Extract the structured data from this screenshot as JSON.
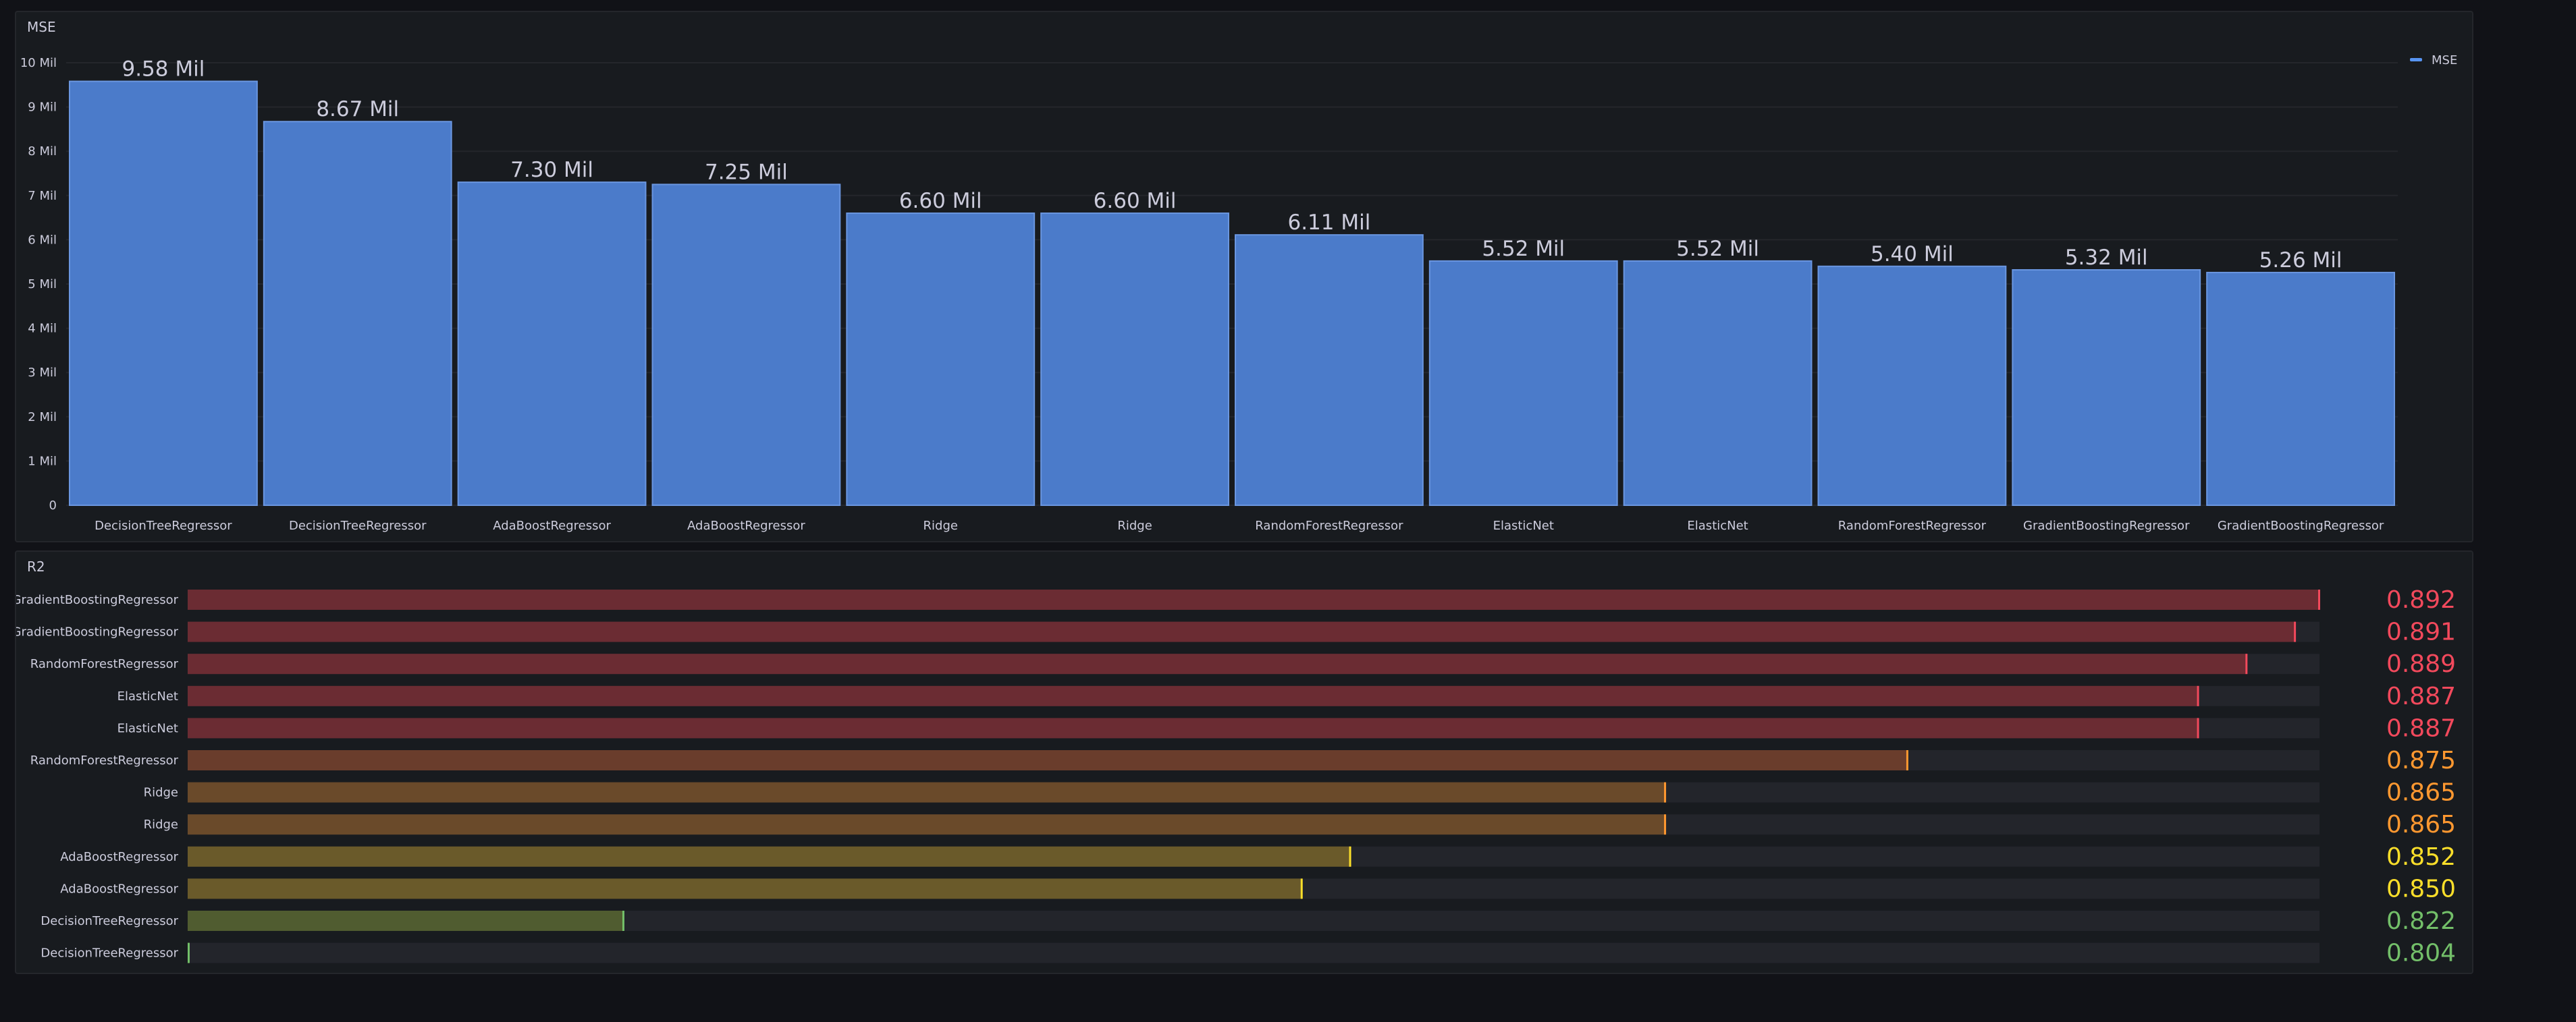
{
  "mse_panel": {
    "title": "MSE"
  },
  "r2_panel": {
    "title": "R2"
  },
  "colors": {
    "bar": "#4b7bca",
    "bar_edge": "#6a96e0",
    "legend": "#5794f2",
    "track": "#23252b"
  },
  "chart_data": [
    {
      "type": "bar",
      "title": "MSE",
      "categories": [
        "DecisionTreeRegressor",
        "DecisionTreeRegressor",
        "AdaBoostRegressor",
        "AdaBoostRegressor",
        "Ridge",
        "Ridge",
        "RandomForestRegressor",
        "ElasticNet",
        "ElasticNet",
        "RandomForestRegressor",
        "GradientBoostingRegressor",
        "GradientBoostingRegressor"
      ],
      "series": [
        {
          "name": "MSE",
          "values": [
            9580000,
            8670000,
            7300000,
            7250000,
            6600000,
            6600000,
            6110000,
            5520000,
            5520000,
            5400000,
            5320000,
            5260000
          ],
          "value_labels": [
            "9.58 Mil",
            "8.67 Mil",
            "7.30 Mil",
            "7.25 Mil",
            "6.60 Mil",
            "6.60 Mil",
            "6.11 Mil",
            "5.52 Mil",
            "5.52 Mil",
            "5.40 Mil",
            "5.32 Mil",
            "5.26 Mil"
          ]
        }
      ],
      "y_ticks": [
        0,
        1000000,
        2000000,
        3000000,
        4000000,
        5000000,
        6000000,
        7000000,
        8000000,
        9000000,
        10000000
      ],
      "y_tick_labels": [
        "0",
        "1 Mil",
        "2 Mil",
        "3 Mil",
        "4 Mil",
        "5 Mil",
        "6 Mil",
        "7 Mil",
        "8 Mil",
        "9 Mil",
        "10 Mil"
      ],
      "ylim": [
        0,
        10000000
      ],
      "grid": true,
      "legend": {
        "position": "top-right",
        "entries": [
          "MSE"
        ]
      }
    },
    {
      "type": "bar",
      "title": "R2",
      "orientation": "horizontal",
      "categories": [
        "GradientBoostingRegressor",
        "GradientBoostingRegressor",
        "RandomForestRegressor",
        "ElasticNet",
        "ElasticNet",
        "RandomForestRegressor",
        "Ridge",
        "Ridge",
        "AdaBoostRegressor",
        "AdaBoostRegressor",
        "DecisionTreeRegressor",
        "DecisionTreeRegressor"
      ],
      "values": [
        0.892,
        0.891,
        0.889,
        0.887,
        0.887,
        0.875,
        0.865,
        0.865,
        0.852,
        0.85,
        0.822,
        0.804
      ],
      "value_labels": [
        "0.892",
        "0.891",
        "0.889",
        "0.887",
        "0.887",
        "0.875",
        "0.865",
        "0.865",
        "0.852",
        "0.850",
        "0.822",
        "0.804"
      ],
      "value_colors": [
        "#f2495c",
        "#f2495c",
        "#f2495c",
        "#f2495c",
        "#f2495c",
        "#ff9830",
        "#ff9830",
        "#ff9830",
        "#fade2a",
        "#fade2a",
        "#73bf69",
        "#73bf69"
      ],
      "bar_fills": [
        "#6b2c33",
        "#6b2c33",
        "#6b2c33",
        "#6b2c33",
        "#6b2c33",
        "#6a3d2c",
        "#6a4a2a",
        "#6a4a2a",
        "#6a5a2a",
        "#6a5a2a",
        "#505c30",
        "#505c30"
      ],
      "xlim": [
        0.804,
        0.892
      ]
    }
  ]
}
